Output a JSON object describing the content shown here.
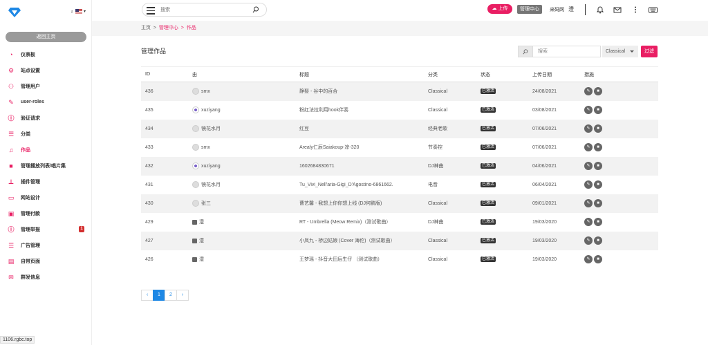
{
  "sidebar": {
    "back_label": "返回主页",
    "items": [
      {
        "label": "仪表板",
        "icon": "speedometer-icon"
      },
      {
        "label": "站点设置",
        "icon": "gear-icon"
      },
      {
        "label": "管理用户",
        "icon": "users-icon"
      },
      {
        "label": "user-roles",
        "icon": "edit-icon"
      },
      {
        "label": "验证请求",
        "icon": "alert-icon"
      },
      {
        "label": "分类",
        "icon": "list-icon"
      },
      {
        "label": "作品",
        "icon": "music-icon",
        "active": true
      },
      {
        "label": "管理播放列表/唱片集",
        "icon": "video-icon"
      },
      {
        "label": "插件管理",
        "icon": "plug-icon"
      },
      {
        "label": "网站设计",
        "icon": "monitor-icon"
      },
      {
        "label": "管理付款",
        "icon": "wallet-icon"
      },
      {
        "label": "管理举报",
        "icon": "info-icon",
        "badge": "1"
      },
      {
        "label": "广告管理",
        "icon": "list-icon"
      },
      {
        "label": "自带页面",
        "icon": "page-icon"
      },
      {
        "label": "群发信息",
        "icon": "mail-icon"
      }
    ],
    "status_url": "1106.rgbc.top"
  },
  "topbar": {
    "search_placeholder": "搜索",
    "upload_label": "上传",
    "admin_label": "管理中心",
    "site_name": "来码网",
    "avatar_text": "澧"
  },
  "breadcrumb": [
    "主页",
    "管理中心",
    "作品"
  ],
  "page_title": "管理作品",
  "filter": {
    "placeholder": "搜索",
    "category": "Classical",
    "button": "过滤"
  },
  "table": {
    "headers": [
      "ID",
      "由",
      "标题",
      "分类",
      "状态",
      "上传日期",
      "措施"
    ],
    "rows": [
      {
        "id": "436",
        "user": "smx",
        "title": "静娶 - 谷中的百合",
        "cat": "Classical",
        "status": "已激活",
        "date": "24/08/2021"
      },
      {
        "id": "435",
        "user": "xuziyang",
        "title": "粉红法拉利用hook伴奏",
        "cat": "Classical",
        "status": "已激活",
        "date": "03/08/2021"
      },
      {
        "id": "434",
        "user": "镜花水月",
        "title": "红豆",
        "cat": "经典老歌",
        "status": "已激活",
        "date": "07/06/2021"
      },
      {
        "id": "433",
        "user": "smx",
        "title": "Arealy仁辰Saiakoup-凉-320",
        "cat": "节奏控",
        "status": "已激活",
        "date": "07/06/2021"
      },
      {
        "id": "432",
        "user": "xuziyang",
        "title": "1602684830671",
        "cat": "DJ神曲",
        "status": "已激活",
        "date": "04/06/2021"
      },
      {
        "id": "431",
        "user": "镜花水月",
        "title": "Tu_Vivi_Nell'aria-Gigi_D'Agostino-6861662.",
        "cat": "电音",
        "status": "已激活",
        "date": "06/04/2021"
      },
      {
        "id": "430",
        "user": "张三",
        "title": "曹艺馨 - 我想上你你想上线 (DJ何鹏版)",
        "cat": "Classical",
        "status": "已激活",
        "date": "09/01/2021"
      },
      {
        "id": "429",
        "user": "澧",
        "title": "RT - Umbrella (Meow Remix)（测试歌曲）",
        "cat": "DJ神曲",
        "status": "已激活",
        "date": "19/03/2020"
      },
      {
        "id": "427",
        "user": "澧",
        "title": "小凤九 - 桥边姑娘 (Cover 海伦)（测试歌曲）",
        "cat": "Classical",
        "status": "已激活",
        "date": "19/03/2020"
      },
      {
        "id": "426",
        "user": "澧",
        "title": "王梦瑶 - 抖音大田后生仔 （测试歌曲）",
        "cat": "Classical",
        "status": "已激活",
        "date": "19/03/2020"
      }
    ]
  },
  "pagination": {
    "prev": "‹",
    "pages": [
      "1",
      "2"
    ],
    "next": "›"
  },
  "colors": {
    "accent": "#e91e63",
    "primary": "#1e88e5"
  }
}
